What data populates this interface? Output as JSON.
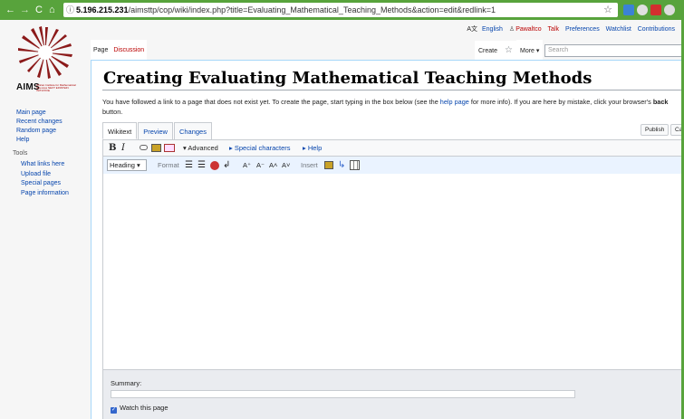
{
  "browser": {
    "nav": {
      "back": "←",
      "forward": "→",
      "reload": "C",
      "home": "⌂"
    },
    "url_host": "5.196.215.231",
    "url_path": "/aimsttp/cop/wiki/index.php?title=Evaluating_Mathematical_Teaching_Methods&action=edit&redlink=1",
    "info_icon": "ⓘ",
    "star_icon": "☆"
  },
  "logo": {
    "text": "AIMS",
    "sub": "African Institute for Mathematical Sciences NEXT EINSTEIN INITIATIVE"
  },
  "sidebar": {
    "navigation": [
      "Main page",
      "Recent changes",
      "Random page",
      "Help"
    ],
    "tools_heading": "Tools",
    "tools": [
      "What links here",
      "Upload file",
      "Special pages",
      "Page information"
    ]
  },
  "personal": {
    "lang_icon": "A文",
    "language": "English",
    "user_icon": "♙",
    "user": "Pawaltco",
    "talk": "Talk",
    "preferences": "Preferences",
    "watchlist": "Watchlist",
    "contributions": "Contributions"
  },
  "tabs": {
    "page": "Page",
    "discussion": "Discussion",
    "create": "Create",
    "watch_icon": "☆",
    "more": "More ▾",
    "search_placeholder": "Search"
  },
  "page": {
    "title": "Creating Evaluating Mathematical Teaching Methods",
    "intro_1": "You have followed a link to a page that does not exist yet. To create the page, start typing in the box below (see the ",
    "intro_link": "help page",
    "intro_2": " for more info). If you are here by mistake, click your browser's ",
    "intro_bold": "back",
    "intro_3": " button."
  },
  "editor": {
    "tabs": [
      "Wikitext",
      "Preview",
      "Changes"
    ],
    "publish": "Publish",
    "cancel": "Ca",
    "toolbar": {
      "bold": "B",
      "italic": "I",
      "advanced": "▾ Advanced",
      "special_characters": "▸ Special characters",
      "help": "▸ Help",
      "heading": "Heading ▾",
      "format": "Format",
      "insert": "Insert"
    },
    "summary_label": "Summary:",
    "watch_label": "Watch this page"
  }
}
